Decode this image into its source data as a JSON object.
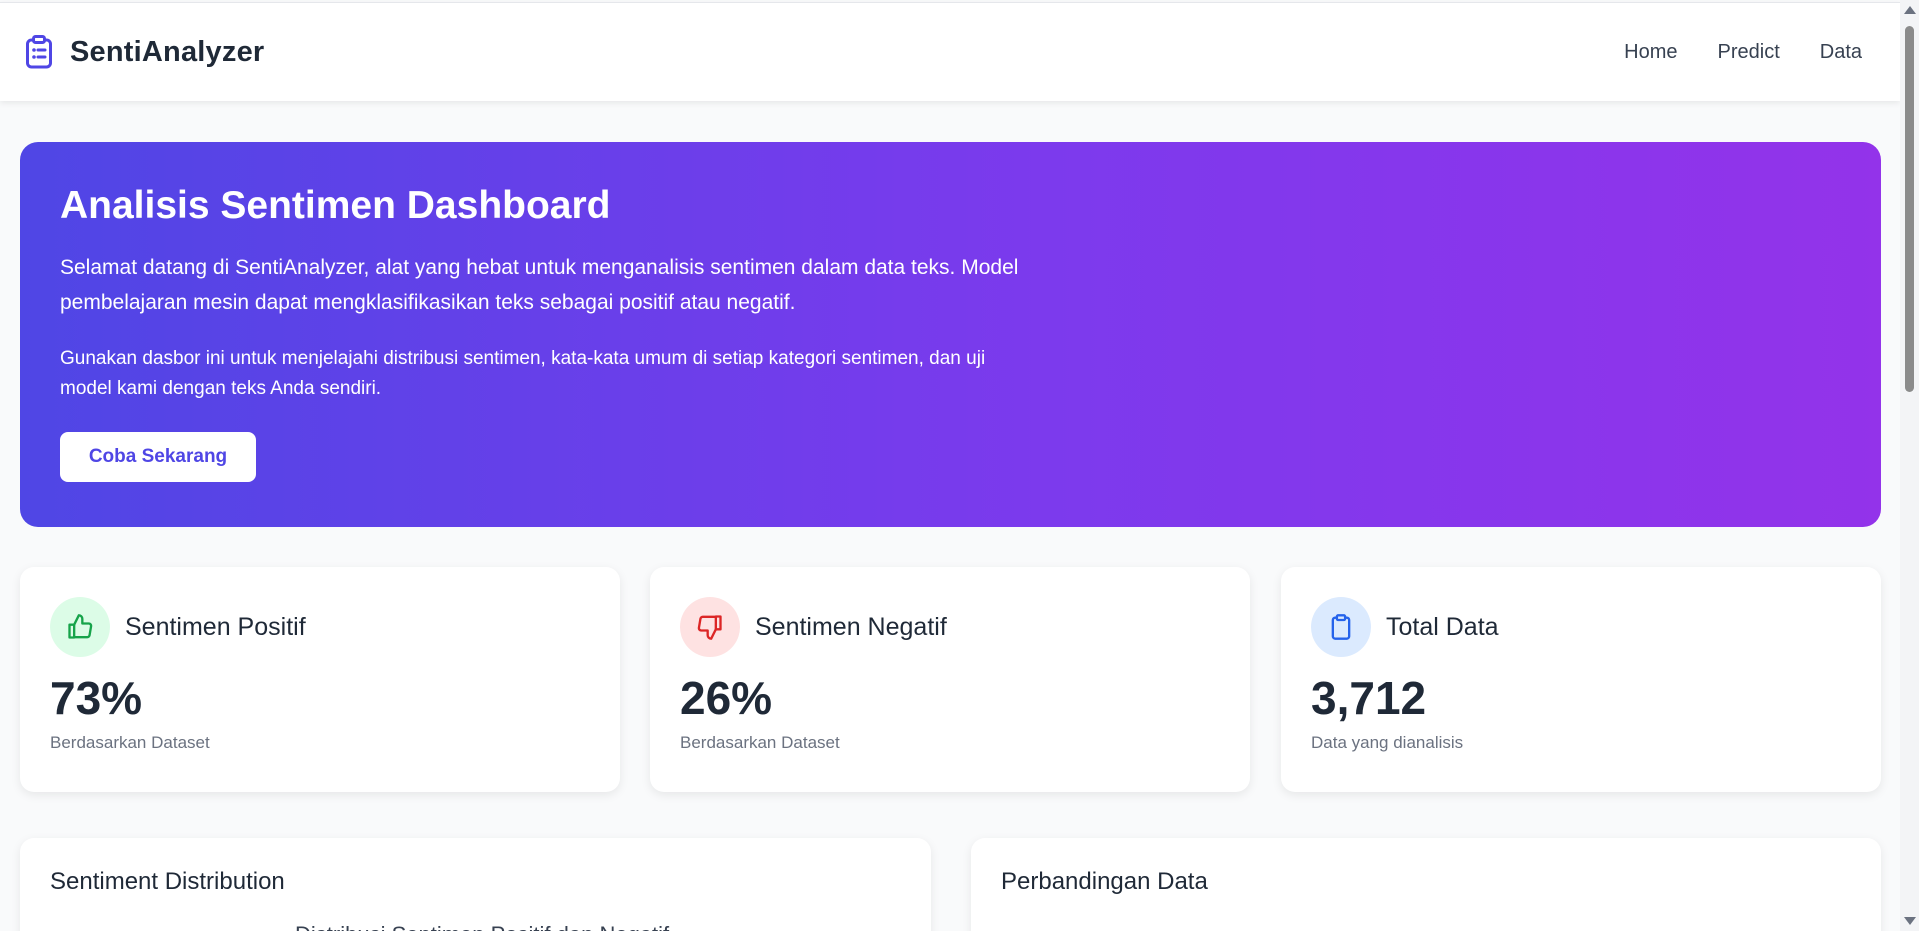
{
  "brand": {
    "name": "SentiAnalyzer",
    "icon": "clipboard-list-icon",
    "icon_color": "#4f46e5"
  },
  "nav": {
    "items": [
      {
        "label": "Home"
      },
      {
        "label": "Predict"
      },
      {
        "label": "Data"
      }
    ]
  },
  "hero": {
    "title": "Analisis Sentimen Dashboard",
    "lead": "Selamat datang di SentiAnalyzer, alat yang hebat untuk menganalisis sentimen dalam data teks. Model pembelajaran mesin dapat mengklasifikasikan teks sebagai positif atau negatif.",
    "note": "Gunakan dasbor ini untuk menjelajahi distribusi sentimen, kata-kata umum di setiap kategori sentimen, dan uji model kami dengan teks Anda sendiri.",
    "button_label": "Coba Sekarang",
    "gradient": [
      "#4f46e5",
      "#9333ea"
    ]
  },
  "stats": [
    {
      "title": "Sentimen Positif",
      "value": "73%",
      "sub": "Berdasarkan Dataset",
      "icon": "thumbs-up-icon",
      "icon_color": "#16a34a",
      "icon_bg": "#dcfce7"
    },
    {
      "title": "Sentimen Negatif",
      "value": "26%",
      "sub": "Berdasarkan Dataset",
      "icon": "thumbs-down-icon",
      "icon_color": "#dc2626",
      "icon_bg": "#fee2e2"
    },
    {
      "title": "Total Data",
      "value": "3,712",
      "sub": "Data yang dianalisis",
      "icon": "clipboard-icon",
      "icon_color": "#2563eb",
      "icon_bg": "#dbeafe"
    }
  ],
  "panels": {
    "distribution": {
      "title": "Sentiment Distribution",
      "chart_title_partial": "Distribusi Sentimen Positif dan Negatif"
    },
    "comparison": {
      "title": "Perbandingan Data"
    }
  }
}
